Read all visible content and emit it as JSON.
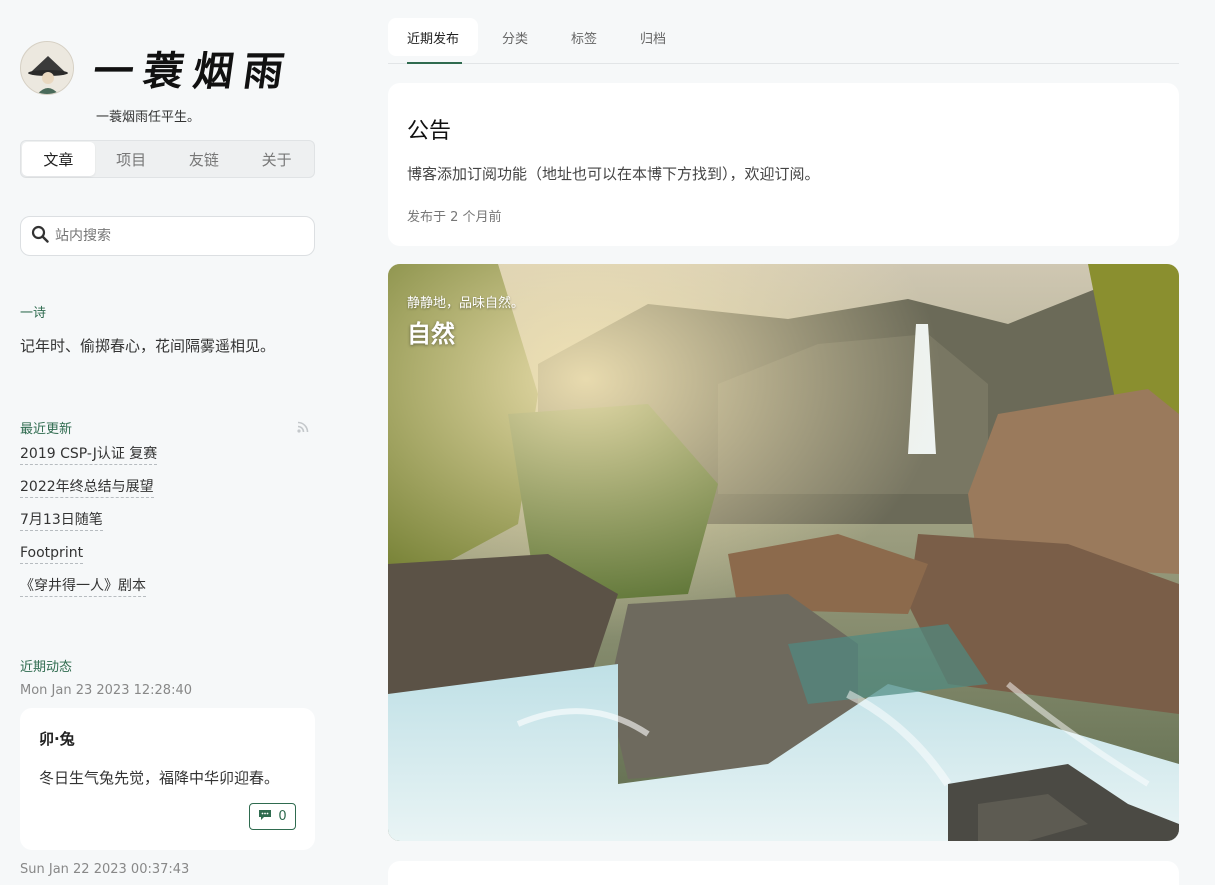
{
  "brand": {
    "logo_title": "一蓑烟雨",
    "tagline": "一蓑烟雨任平生。"
  },
  "side_tabs": [
    {
      "label": "文章",
      "active": true
    },
    {
      "label": "项目",
      "active": false
    },
    {
      "label": "友链",
      "active": false
    },
    {
      "label": "关于",
      "active": false
    }
  ],
  "search": {
    "placeholder": "站内搜索",
    "icon": "search-icon"
  },
  "poem": {
    "label": "一诗",
    "text": "记年时、偷掷春心，花间隔雾遥相见。"
  },
  "updates": {
    "label": "最近更新",
    "rss_icon": "rss-icon",
    "items": [
      "2019 CSP-J认证 复赛",
      "2022年终总结与展望",
      "7月13日随笔",
      "Footprint",
      "《穿井得一人》剧本"
    ]
  },
  "dynamics": {
    "label": "近期动态",
    "date": "Mon Jan 23 2023 12:28:40",
    "moment_title": "卯·兔",
    "moment_text": "冬日生气兔先觉，福降中华卯迎春。",
    "comment_count": "0",
    "next_date": "Sun Jan 22 2023 00:37:43"
  },
  "top_nav": [
    {
      "label": "近期发布",
      "active": true
    },
    {
      "label": "分类",
      "active": false
    },
    {
      "label": "标签",
      "active": false
    },
    {
      "label": "归档",
      "active": false
    }
  ],
  "notice": {
    "title": "公告",
    "text": "博客添加订阅功能（地址也可以在本博下方找到），欢迎订阅。",
    "meta": "发布于 2 个月前"
  },
  "hero": {
    "subtitle": "静静地，品味自然。",
    "title": "自然"
  },
  "colors": {
    "accent": "#2f6b4f",
    "background": "#f6f8f9"
  }
}
